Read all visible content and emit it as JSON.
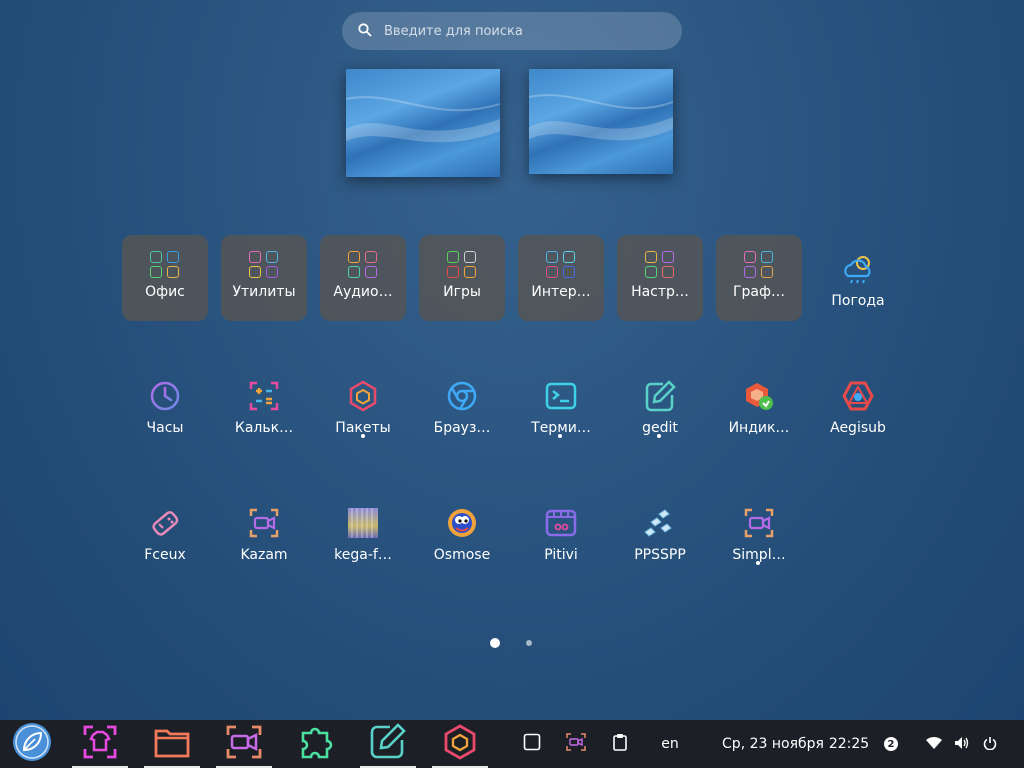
{
  "search": {
    "placeholder": "Введите для поиска"
  },
  "workspaces": [
    "workspace-1",
    "workspace-2"
  ],
  "row1": [
    {
      "label": "Офис",
      "name": "folder-office",
      "type": "folder",
      "colors": [
        "#4fc7a3",
        "#3a9de8",
        "#5ad178",
        "#e8b64a"
      ]
    },
    {
      "label": "Утилиты",
      "name": "folder-utilities",
      "type": "folder",
      "colors": [
        "#e66bb8",
        "#4ab6e8",
        "#f1c34a",
        "#a45ae8"
      ]
    },
    {
      "label": "Аудио…",
      "name": "folder-audio",
      "type": "folder",
      "colors": [
        "#f0a33b",
        "#e66b8a",
        "#4fd1a3",
        "#b56be8"
      ]
    },
    {
      "label": "Игры",
      "name": "folder-games",
      "type": "folder",
      "colors": [
        "#5ad15a",
        "#cfcfcf",
        "#e84a4a",
        "#f1a33b"
      ]
    },
    {
      "label": "Интер…",
      "name": "folder-internet",
      "type": "folder",
      "colors": [
        "#4ab6e8",
        "#5ad1e8",
        "#e84a8a",
        "#4a6be8"
      ]
    },
    {
      "label": "Настр…",
      "name": "folder-settings",
      "type": "folder",
      "colors": [
        "#e8b64a",
        "#b56be8",
        "#5ad178",
        "#e86b6b"
      ]
    },
    {
      "label": "Граф…",
      "name": "folder-graphics",
      "type": "folder",
      "colors": [
        "#e66bb8",
        "#4ab6e8",
        "#b56be8",
        "#e8a04a"
      ]
    },
    {
      "label": "Погода",
      "name": "app-weather",
      "type": "app",
      "icon": "weather-icon"
    }
  ],
  "row2": [
    {
      "label": "Часы",
      "name": "app-clock",
      "icon": "clock-icon",
      "running": false
    },
    {
      "label": "Кальк…",
      "name": "app-calculator",
      "icon": "calculator-icon",
      "running": false
    },
    {
      "label": "Пакеты",
      "name": "app-packages",
      "icon": "package-icon",
      "running": true
    },
    {
      "label": "Брауз…",
      "name": "app-browser",
      "icon": "browser-icon",
      "running": false
    },
    {
      "label": "Терми…",
      "name": "app-terminal",
      "icon": "terminal-icon",
      "running": true
    },
    {
      "label": "gedit",
      "name": "app-gedit",
      "icon": "edit-icon",
      "running": true
    },
    {
      "label": "Индик…",
      "name": "app-indicator",
      "icon": "update-indicator-icon",
      "running": false
    },
    {
      "label": "Aegisub",
      "name": "app-aegisub",
      "icon": "aegisub-icon",
      "running": false
    }
  ],
  "row3": [
    {
      "label": "Fceux",
      "name": "app-fceux",
      "icon": "gamepad-icon",
      "running": false
    },
    {
      "label": "Kazam",
      "name": "app-kazam",
      "icon": "screen-recorder-icon",
      "running": false
    },
    {
      "label": "kega-f…",
      "name": "app-kega-fusion",
      "icon": "kega-icon",
      "running": false
    },
    {
      "label": "Osmose",
      "name": "app-osmose",
      "icon": "osmose-icon",
      "running": false
    },
    {
      "label": "Pitivi",
      "name": "app-pitivi",
      "icon": "video-editor-icon",
      "running": false
    },
    {
      "label": "PPSSPP",
      "name": "app-ppsspp",
      "icon": "ppsspp-icon",
      "running": false
    },
    {
      "label": "Simpl…",
      "name": "app-simplescreenrecorder",
      "icon": "screen-recorder-icon",
      "running": true
    }
  ],
  "pager": {
    "pages": 2,
    "current": 1
  },
  "taskbar": {
    "start": "start-menu-icon",
    "apps": [
      "shirt-icon",
      "folder-icon",
      "screen-recorder-icon",
      "puzzle-icon",
      "edit-icon",
      "package-icon"
    ],
    "tray_icons": [
      "window-icon",
      "screen-recorder-icon",
      "clipboard-icon"
    ],
    "keyboard_layout": "en",
    "date": "Ср, 23 ноября",
    "time": "22:25",
    "notifications": "2",
    "status_icons": [
      "wifi-icon",
      "volume-icon",
      "power-icon"
    ]
  }
}
